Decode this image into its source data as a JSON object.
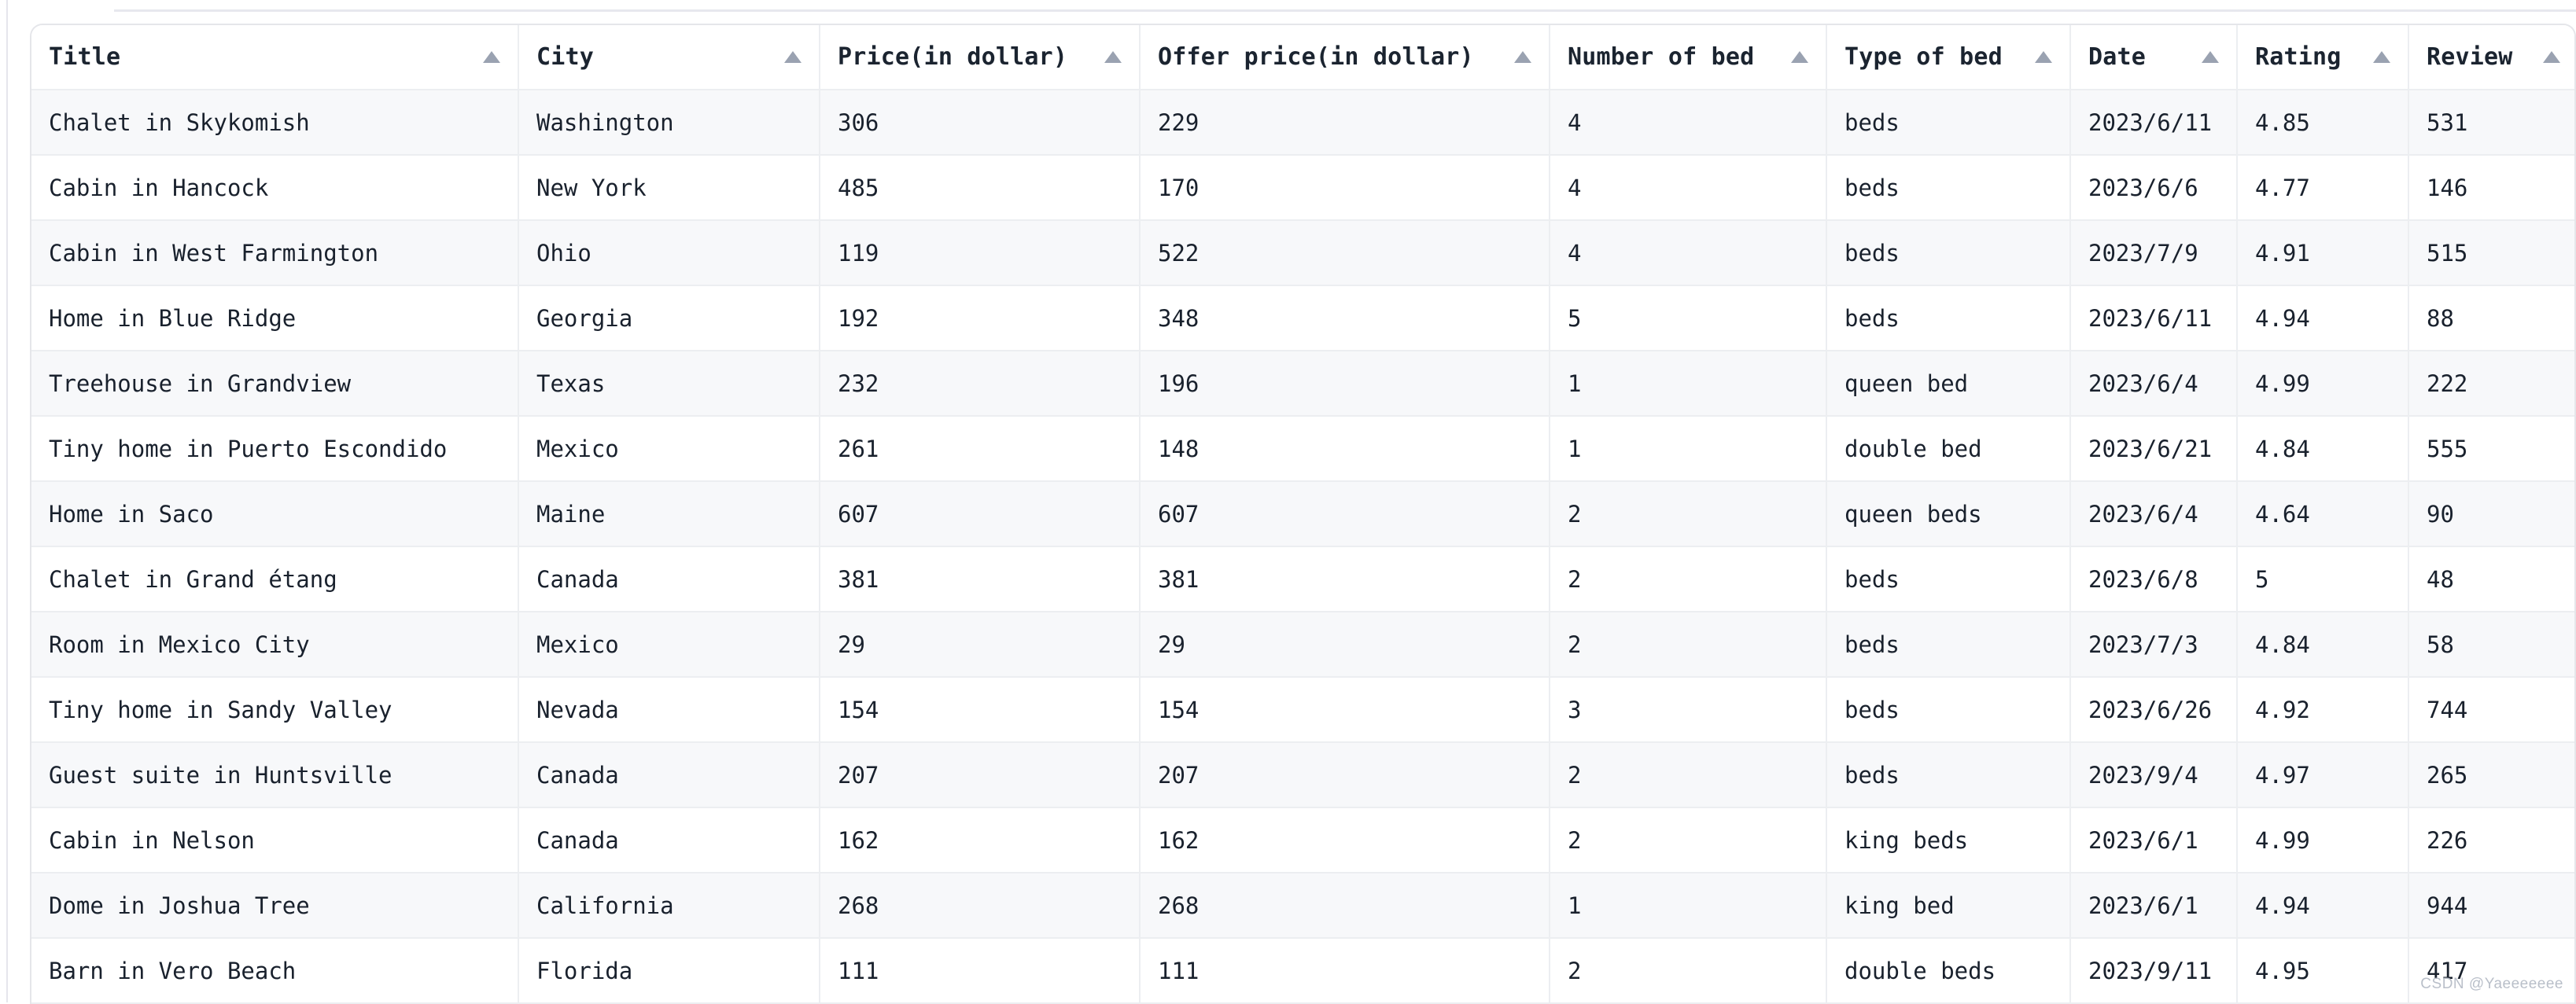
{
  "watermark": "CSDN @Yaeeeeeee",
  "table": {
    "sort_icon": "sort-ascending-triangle-icon",
    "columns": [
      {
        "key": "title",
        "label": "Title"
      },
      {
        "key": "city",
        "label": "City"
      },
      {
        "key": "price",
        "label": "Price(in dollar)"
      },
      {
        "key": "offer",
        "label": "Offer price(in dollar)"
      },
      {
        "key": "beds",
        "label": "Number of bed"
      },
      {
        "key": "bedtype",
        "label": "Type of bed"
      },
      {
        "key": "date",
        "label": "Date"
      },
      {
        "key": "rating",
        "label": "Rating"
      },
      {
        "key": "review",
        "label": "Review"
      }
    ],
    "rows": [
      {
        "title": "Chalet in Skykomish",
        "city": "Washington",
        "price": "306",
        "offer": "229",
        "beds": "4",
        "bedtype": "beds",
        "date": "2023/6/11",
        "rating": "4.85",
        "review": "531"
      },
      {
        "title": "Cabin in Hancock",
        "city": "New York",
        "price": "485",
        "offer": "170",
        "beds": "4",
        "bedtype": "beds",
        "date": "2023/6/6",
        "rating": "4.77",
        "review": "146"
      },
      {
        "title": "Cabin in West Farmington",
        "city": "Ohio",
        "price": "119",
        "offer": "522",
        "beds": "4",
        "bedtype": "beds",
        "date": "2023/7/9",
        "rating": "4.91",
        "review": "515"
      },
      {
        "title": "Home in Blue Ridge",
        "city": "Georgia",
        "price": "192",
        "offer": "348",
        "beds": "5",
        "bedtype": "beds",
        "date": "2023/6/11",
        "rating": "4.94",
        "review": "88"
      },
      {
        "title": "Treehouse in Grandview",
        "city": "Texas",
        "price": "232",
        "offer": "196",
        "beds": "1",
        "bedtype": "queen bed",
        "date": "2023/6/4",
        "rating": "4.99",
        "review": "222"
      },
      {
        "title": "Tiny home in Puerto Escondido",
        "city": "Mexico",
        "price": "261",
        "offer": "148",
        "beds": "1",
        "bedtype": "double bed",
        "date": "2023/6/21",
        "rating": "4.84",
        "review": "555"
      },
      {
        "title": "Home in Saco",
        "city": "Maine",
        "price": "607",
        "offer": "607",
        "beds": "2",
        "bedtype": "queen beds",
        "date": "2023/6/4",
        "rating": "4.64",
        "review": "90"
      },
      {
        "title": "Chalet in Grand étang",
        "city": "Canada",
        "price": "381",
        "offer": "381",
        "beds": "2",
        "bedtype": "beds",
        "date": "2023/6/8",
        "rating": "5",
        "review": "48"
      },
      {
        "title": "Room in Mexico City",
        "city": "Mexico",
        "price": "29",
        "offer": "29",
        "beds": "2",
        "bedtype": "beds",
        "date": "2023/7/3",
        "rating": "4.84",
        "review": "58"
      },
      {
        "title": "Tiny home in Sandy Valley",
        "city": "Nevada",
        "price": "154",
        "offer": "154",
        "beds": "3",
        "bedtype": "beds",
        "date": "2023/6/26",
        "rating": "4.92",
        "review": "744"
      },
      {
        "title": "Guest suite in Huntsville",
        "city": "Canada",
        "price": "207",
        "offer": "207",
        "beds": "2",
        "bedtype": "beds",
        "date": "2023/9/4",
        "rating": "4.97",
        "review": "265"
      },
      {
        "title": "Cabin in Nelson",
        "city": "Canada",
        "price": "162",
        "offer": "162",
        "beds": "2",
        "bedtype": "king beds",
        "date": "2023/6/1",
        "rating": "4.99",
        "review": "226"
      },
      {
        "title": "Dome in Joshua Tree",
        "city": "California",
        "price": "268",
        "offer": "268",
        "beds": "1",
        "bedtype": "king bed",
        "date": "2023/6/1",
        "rating": "4.94",
        "review": "944"
      },
      {
        "title": "Barn in Vero Beach",
        "city": "Florida",
        "price": "111",
        "offer": "111",
        "beds": "2",
        "bedtype": "double beds",
        "date": "2023/9/11",
        "rating": "4.95",
        "review": "417"
      }
    ]
  },
  "colors": {
    "header_text": "#1b2430",
    "cell_text": "#19212d",
    "grid_line": "#eceef1",
    "card_border": "#e5e6ea",
    "stripe_bg": "#f7f8fa",
    "row_bg": "#ffffff",
    "sort_arrow": "#9aa2b1",
    "watermark": "#b9bfc9"
  }
}
